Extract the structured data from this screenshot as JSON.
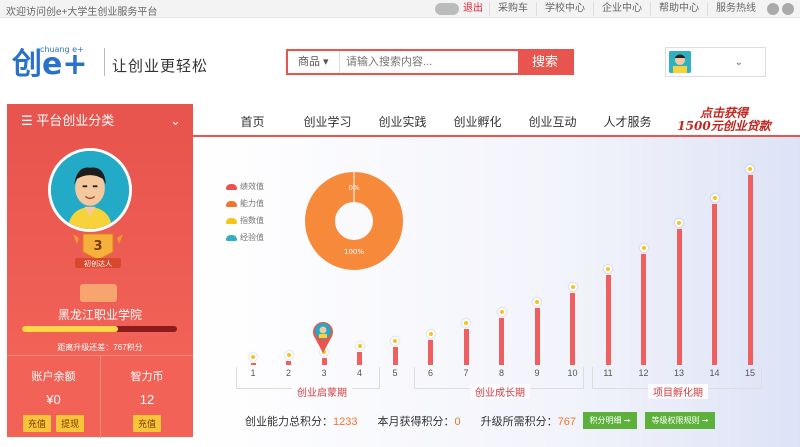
{
  "topbar": {
    "welcome": "欢迎访问创e+大学生创业服务平台",
    "logout": "退出",
    "links": [
      "采购车",
      "学校中心",
      "企业中心",
      "帮助中心",
      "服务热线"
    ]
  },
  "header": {
    "logo_text": "创e+",
    "logo_sub": "chuang e+",
    "slogan": "让创业更轻松",
    "search_category": "商品",
    "search_placeholder": "请输入搜索内容...",
    "search_button": "搜索"
  },
  "nav": {
    "category_label": "平台创业分类",
    "items": [
      "首页",
      "创业学习",
      "创业实践",
      "创业孵化",
      "创业互动",
      "人才服务"
    ],
    "promo_line1": "点击获得",
    "promo_line2": "1500元创业贷款"
  },
  "profile": {
    "level": "3",
    "level_badge": "初创达人",
    "school": "黑龙江职业学院",
    "progress": 0.62,
    "progress_text": "距离升级还差：767积分",
    "balance_label": "账户余额",
    "balance_value": "¥0",
    "recharge": "充值",
    "withdraw": "提现",
    "coin_label": "智力币",
    "coin_value": "12",
    "coin_recharge": "充值"
  },
  "chart_data": {
    "type": "bar",
    "legend": [
      {
        "label": "绩效值",
        "color": "#e8554e"
      },
      {
        "label": "能力值",
        "color": "#f0742b"
      },
      {
        "label": "指数值",
        "color": "#f6c318"
      },
      {
        "label": "经验值",
        "color": "#31b0c3"
      }
    ],
    "pie": {
      "label_top": "0%",
      "label_bottom": "100%",
      "color": "#f68a3a"
    },
    "categories": [
      "1",
      "2",
      "3",
      "4",
      "5",
      "6",
      "7",
      "8",
      "9",
      "10",
      "11",
      "12",
      "13",
      "14",
      "15"
    ],
    "values": [
      0.5,
      1,
      2,
      3.5,
      5,
      7,
      10,
      13,
      16,
      20,
      25,
      31,
      38,
      45,
      53
    ],
    "current_level": 3,
    "stages": [
      "创业启蒙期",
      "创业成长期",
      "项目孵化期"
    ]
  },
  "stats": {
    "total_label": "创业能力总积分：",
    "total_value": "1233",
    "month_label": "本月获得积分：",
    "month_value": "0",
    "need_label": "升级所需积分：",
    "need_value": "767",
    "detail_button": "积分明细 ➞",
    "rules_button": "等级权限规则 ➞"
  }
}
